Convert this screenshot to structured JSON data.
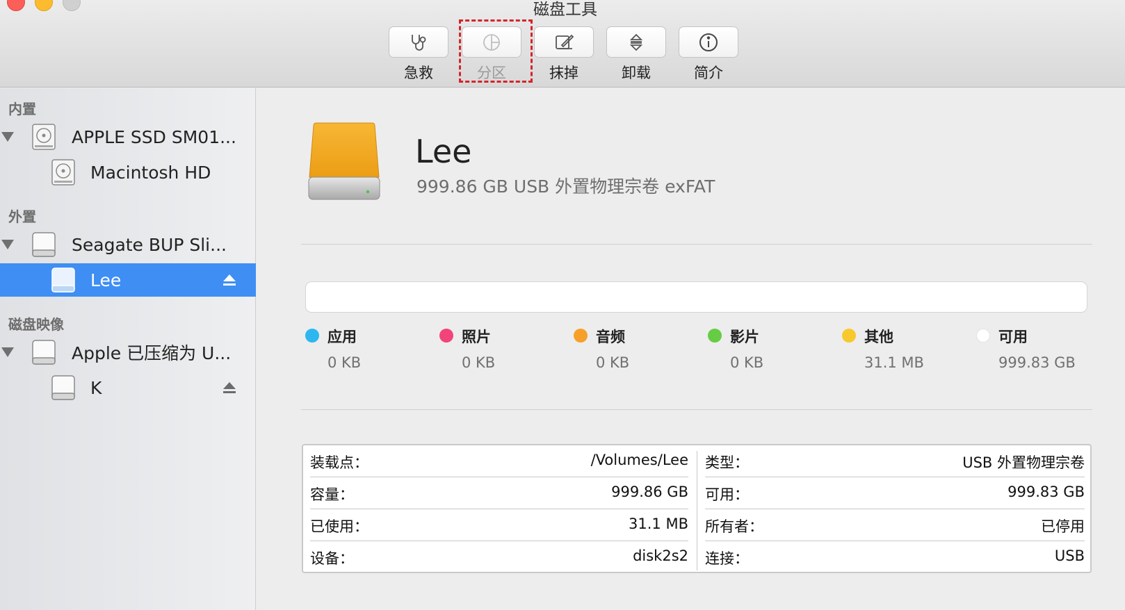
{
  "window": {
    "title": "磁盘工具"
  },
  "toolbar": {
    "buttons": [
      {
        "label": "急救",
        "icon": "stethoscope-icon",
        "enabled": true
      },
      {
        "label": "分区",
        "icon": "pie-partition-icon",
        "enabled": false
      },
      {
        "label": "抹掉",
        "icon": "erase-pencil-icon",
        "enabled": true
      },
      {
        "label": "卸载",
        "icon": "unmount-icon",
        "enabled": true
      },
      {
        "label": "简介",
        "icon": "info-icon",
        "enabled": true
      }
    ]
  },
  "sidebar": {
    "sections": [
      {
        "header": "内置"
      },
      {
        "header": "外置"
      },
      {
        "header": "磁盘映像"
      }
    ],
    "items": [
      {
        "label": "APPLE SSD SM01...",
        "icon": "internal-drive-icon"
      },
      {
        "label": "Macintosh HD",
        "icon": "internal-drive-icon"
      },
      {
        "label": "Seagate BUP Sli...",
        "icon": "external-drive-icon"
      },
      {
        "label": "Lee",
        "icon": "external-drive-icon",
        "selected": true,
        "eject": true
      },
      {
        "label": "Apple 已压缩为 U...",
        "icon": "disk-image-icon"
      },
      {
        "label": "K",
        "icon": "disk-image-icon",
        "eject": true
      }
    ]
  },
  "volume": {
    "name": "Lee",
    "description": "999.86 GB USB 外置物理宗卷 exFAT",
    "icon": "external-orange-drive-icon"
  },
  "usage_legend": [
    {
      "name": "应用",
      "size": "0 KB",
      "color": "#2eb6f0"
    },
    {
      "name": "照片",
      "size": "0 KB",
      "color": "#f2447a"
    },
    {
      "name": "音频",
      "size": "0 KB",
      "color": "#f6a02a"
    },
    {
      "name": "影片",
      "size": "0 KB",
      "color": "#66cc44"
    },
    {
      "name": "其他",
      "size": "31.1 MB",
      "color": "#f8c92c"
    },
    {
      "name": "可用",
      "size": "999.83 GB",
      "color": "#ffffff"
    }
  ],
  "info": {
    "left": [
      {
        "key": "装载点：",
        "value": "/Volumes/Lee"
      },
      {
        "key": "容量：",
        "value": "999.86 GB"
      },
      {
        "key": "已使用：",
        "value": "31.1 MB"
      },
      {
        "key": "设备：",
        "value": "disk2s2"
      }
    ],
    "right": [
      {
        "key": "类型：",
        "value": "USB 外置物理宗卷"
      },
      {
        "key": "可用：",
        "value": "999.83 GB"
      },
      {
        "key": "所有者：",
        "value": "已停用"
      },
      {
        "key": "连接：",
        "value": "USB"
      }
    ]
  },
  "colors": {
    "selection": "#3e8ef3",
    "annotation": "#d4242b"
  }
}
